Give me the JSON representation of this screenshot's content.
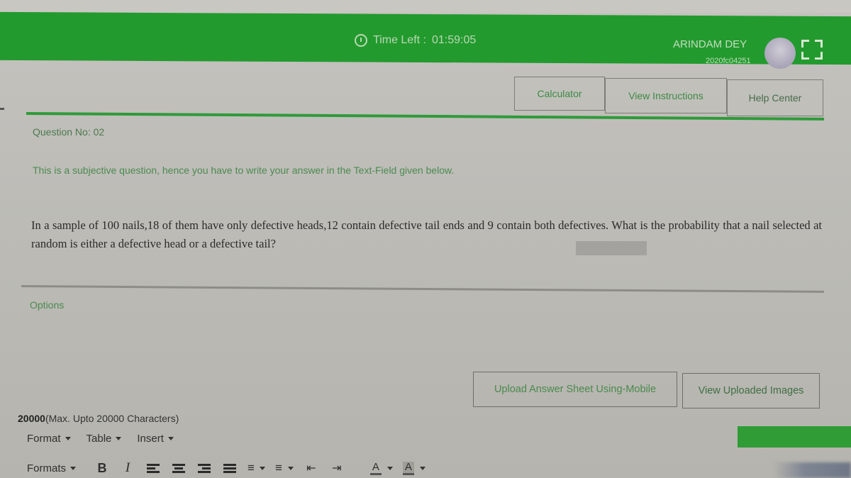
{
  "header": {
    "timer_label": "Time Left :",
    "timer_value": "01:59:05",
    "user_name": "ARINDAM DEY",
    "user_id": "2020fc04251",
    "icons": {
      "timer": "clock-icon",
      "avatar": "user-avatar",
      "fullscreen": "fullscreen-icon"
    }
  },
  "nav": {
    "calculator": "Calculator",
    "view_instructions": "View Instructions",
    "help_center": "Help Center"
  },
  "question": {
    "number_label": "Question No: 02",
    "instruction": "This is a subjective question, hence you have to write your answer in the Text-Field given below.",
    "text": "In a sample of 100 nails,18 of them have only defective heads,12 contain defective tail ends and 9 contain both defectives. What is the probability that a nail selected at random is either a defective head or a defective tail?"
  },
  "options": {
    "label": "Options"
  },
  "actions": {
    "upload_mobile": "Upload Answer Sheet Using-Mobile",
    "view_uploaded": "View Uploaded Images"
  },
  "editor": {
    "char_count": "20000",
    "char_limit_text": "(Max. Upto 20000 Characters)",
    "menus": [
      "Format",
      "Table",
      "Insert"
    ],
    "toolbar": {
      "formats": "Formats",
      "bold": "B",
      "italic": "I",
      "text_color": "A",
      "background_color": "A"
    }
  },
  "colors": {
    "header_green": "#239a2e",
    "accent_green": "#2f9a3a",
    "link_green": "#4b8a4f"
  }
}
